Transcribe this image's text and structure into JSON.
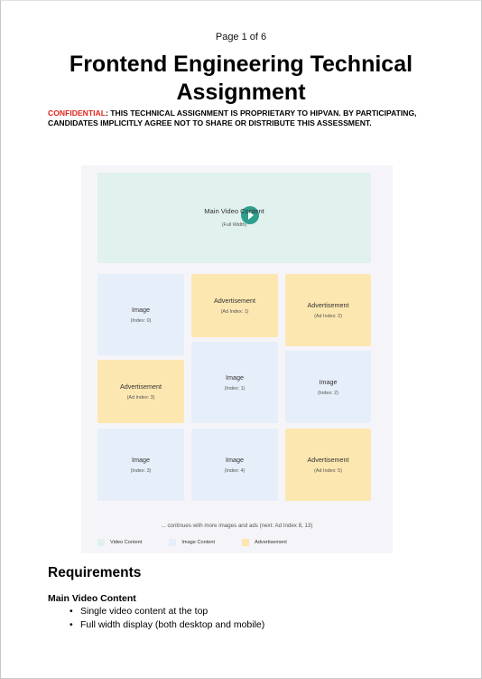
{
  "page_number": "Page 1 of 6",
  "title": "Frontend Engineering Technical Assignment",
  "confidential_label": "CONFIDENTIAL",
  "confidential_text": ": THIS TECHNICAL ASSIGNMENT IS PROPRIETARY TO HIPVAN. BY PARTICIPATING, CANDIDATES IMPLICITLY AGREE NOT TO SHARE OR DISTRIBUTE THIS ASSESSMENT.",
  "figure": {
    "video": {
      "label": "Main Video Content",
      "sub": "(Full Width)",
      "icon": "play-icon"
    },
    "tiles": [
      {
        "kind": "image",
        "label": "Image",
        "sub": "(Index: 0)"
      },
      {
        "kind": "ad",
        "label": "Advertisement",
        "sub": "(Ad Index: 1)"
      },
      {
        "kind": "ad",
        "label": "Advertisement",
        "sub": "(Ad Index: 2)"
      },
      {
        "kind": "image",
        "label": "Image",
        "sub": "(Index: 1)"
      },
      {
        "kind": "ad",
        "label": "Advertisement",
        "sub": "(Ad Index: 3)"
      },
      {
        "kind": "image",
        "label": "Image",
        "sub": "(Index: 2)"
      },
      {
        "kind": "image",
        "label": "Image",
        "sub": "(Index: 3)"
      },
      {
        "kind": "image",
        "label": "Image",
        "sub": "(Index: 4)"
      },
      {
        "kind": "ad",
        "label": "Advertisement",
        "sub": "(Ad Index: 5)"
      }
    ],
    "continues": "... continues with more images and ads (next: Ad Index 8, 13)",
    "legend": [
      {
        "label": "Video Content",
        "color": "#e0f1ee"
      },
      {
        "label": "Image Content",
        "color": "#e6eef9"
      },
      {
        "label": "Advertisement",
        "color": "#fde7b0"
      }
    ]
  },
  "requirements": {
    "heading": "Requirements",
    "subheading": "Main Video Content",
    "items": [
      "Single video content at the top",
      "Full width display (both desktop and mobile)"
    ]
  }
}
